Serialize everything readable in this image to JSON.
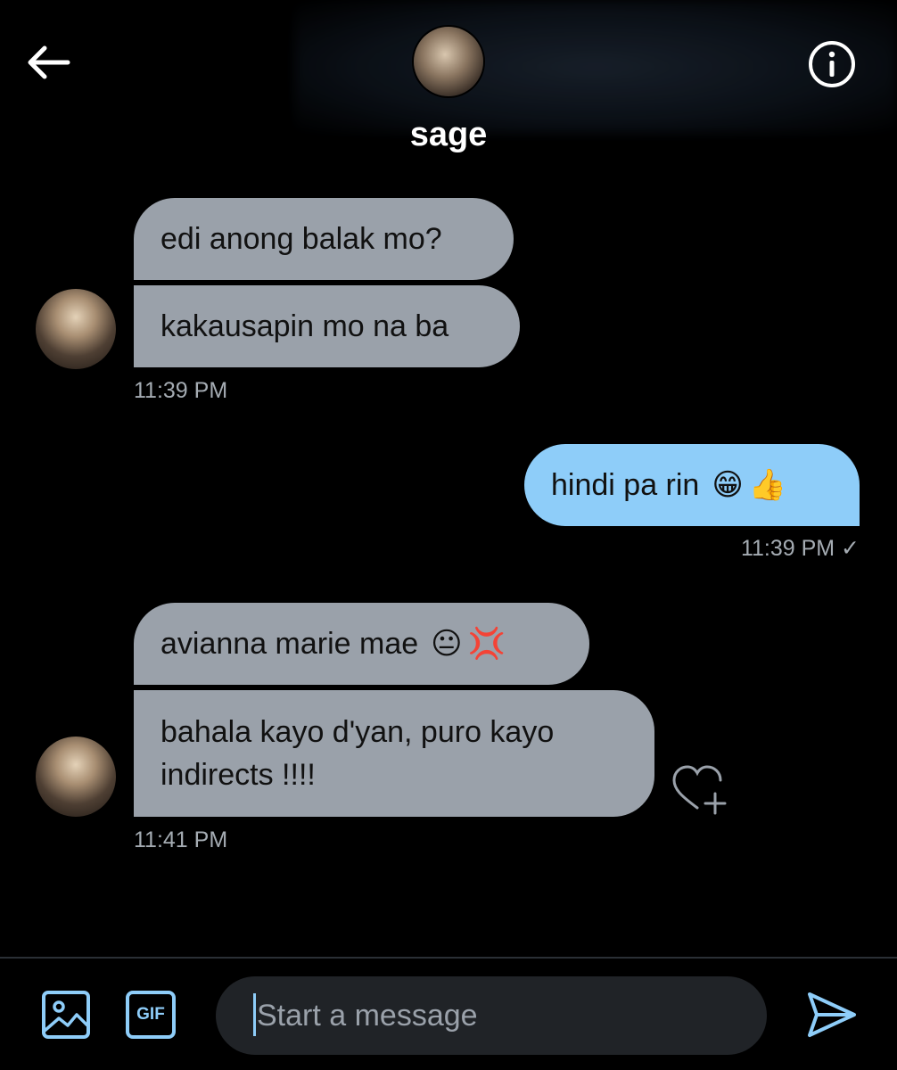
{
  "header": {
    "title": "sage"
  },
  "messages": [
    {
      "direction": "received",
      "bubbles": [
        {
          "text": "edi anong balak mo?"
        },
        {
          "text": "kakausapin mo na ba"
        }
      ],
      "time": "11:39 PM"
    },
    {
      "direction": "sent",
      "bubbles": [
        {
          "text": "hindi pa rin",
          "emojis": [
            "😁",
            "👍"
          ]
        }
      ],
      "time": "11:39 PM ✓"
    },
    {
      "direction": "received",
      "bubbles": [
        {
          "text": "avianna marie mae",
          "emojis": [
            "😐",
            "💢"
          ]
        },
        {
          "line1": "bahala kayo d'yan, puro kayo",
          "line2": "indirects !!!!"
        }
      ],
      "time": "11:41 PM"
    }
  ],
  "composer": {
    "placeholder": "Start a message",
    "gif_label": "GIF"
  },
  "colors": {
    "received_bubble": "#9aa1aa",
    "sent_bubble": "#8ecdf9",
    "accent": "#8ecdf9",
    "background": "#000000"
  },
  "icons": [
    "back-arrow-icon",
    "info-icon",
    "image-icon",
    "gif-icon",
    "send-icon",
    "heart-plus-icon"
  ]
}
